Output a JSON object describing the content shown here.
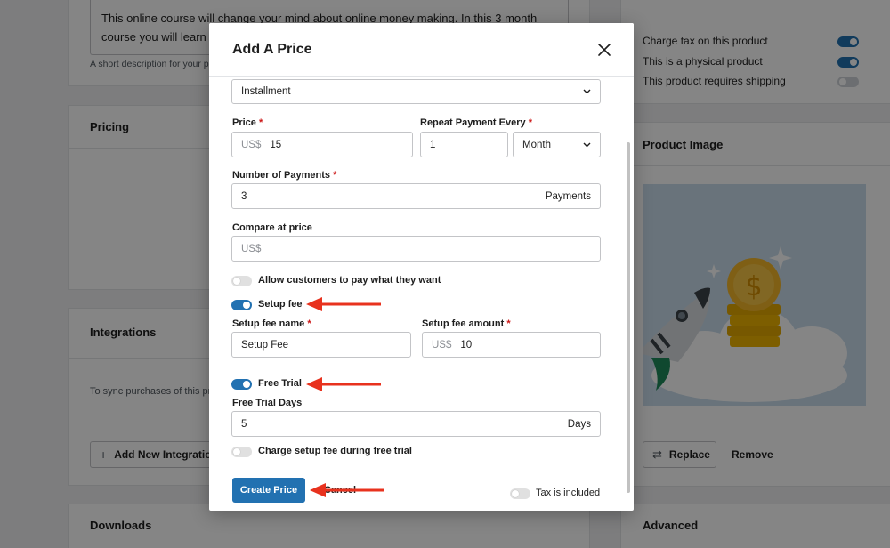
{
  "background": {
    "description_text": "This online course will change your mind about online money making. In this 3 month course you will learn safe practices on l",
    "description_help": "A short description for your p",
    "pricing_title": "Pricing",
    "integrations_title": "Integrations",
    "integrations_help": "To sync purchases of this pr",
    "add_integration_label": "Add New Integratio",
    "downloads_title": "Downloads",
    "side_options": [
      {
        "label": "Charge tax on this product",
        "on": true
      },
      {
        "label": "This is a physical product",
        "on": true
      },
      {
        "label": "This product requires shipping",
        "on": false
      }
    ],
    "product_image_title": "Product Image",
    "replace_label": "Replace",
    "remove_label": "Remove",
    "advanced_title": "Advanced"
  },
  "modal": {
    "title": "Add A Price",
    "price_type": "Installment",
    "price_label": "Price",
    "price_prefix": "US$",
    "price_value": "15",
    "repeat_label": "Repeat Payment Every",
    "repeat_value": "1",
    "repeat_unit": "Month",
    "num_payments_label": "Number of Payments",
    "num_payments_value": "3",
    "num_payments_suffix": "Payments",
    "compare_label": "Compare at price",
    "compare_prefix": "US$",
    "allow_pwyw_label": "Allow customers to pay what they want",
    "allow_pwyw_on": false,
    "setup_fee_label": "Setup fee",
    "setup_fee_on": true,
    "setup_fee_name_label": "Setup fee name",
    "setup_fee_name_value": "Setup Fee",
    "setup_fee_amount_label": "Setup fee amount",
    "setup_fee_amount_prefix": "US$",
    "setup_fee_amount_value": "10",
    "free_trial_label": "Free Trial",
    "free_trial_on": true,
    "free_trial_days_label": "Free Trial Days",
    "free_trial_days_value": "5",
    "free_trial_days_suffix": "Days",
    "charge_setup_label": "Charge setup fee during free trial",
    "charge_setup_on": false,
    "create_button": "Create Price",
    "cancel_link": "Cancel",
    "tax_included_label": "Tax is included",
    "tax_included_on": false
  },
  "colors": {
    "accent": "#2271b1",
    "annotation_arrow": "#e8321e",
    "required": "#cc1818"
  }
}
